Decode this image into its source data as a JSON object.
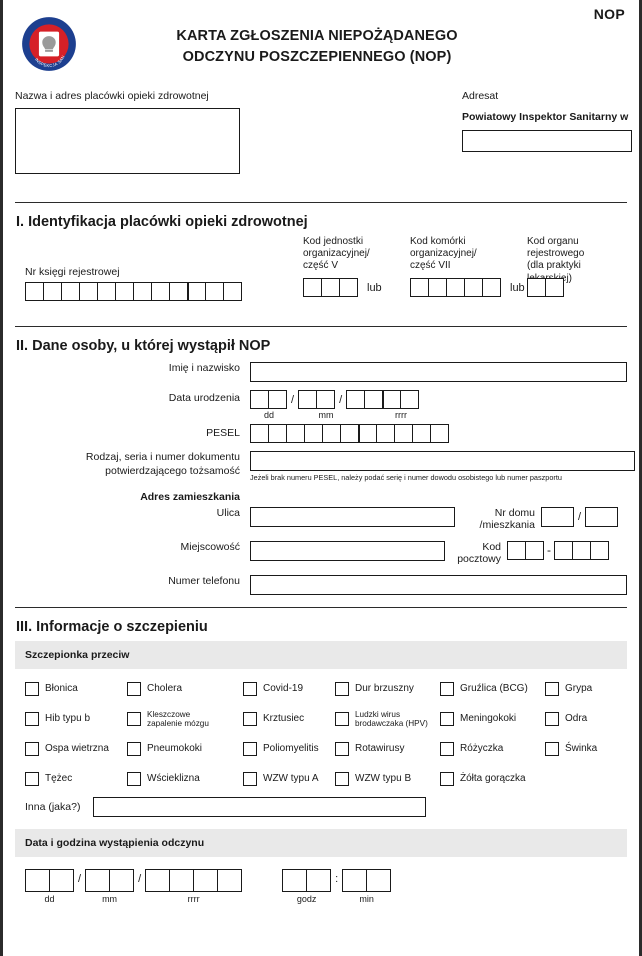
{
  "header": {
    "nop_tag": "NOP",
    "title_line1": "KARTA ZGŁOSZENIA NIEPOŻĄDANEGO",
    "title_line2": "ODCZYNU POSZCZEPIENNEGO (NOP)",
    "logo_top_text": "PAŃSTWOWA",
    "logo_bottom_text": "INSPEKCJA SANITARNA"
  },
  "top": {
    "facility_label": "Nazwa i adres placówki opieki zdrowotnej",
    "addressee_label": "Adresat",
    "addressee_value": "Powiatowy Inspektor Sanitarny w",
    "facility_value": "",
    "addressee_input_value": ""
  },
  "section1": {
    "title": "I. Identyfikacja placówki opieki zdrowotnej",
    "register_label": "Nr księgi rejestrowej",
    "register_boxes": 12,
    "register_divider_after": 9,
    "org_unit_label": "Kod jednostki\norganizacyjnej/\nczęść V",
    "org_unit_label_l1": "Kod jednostki",
    "org_unit_label_l2": "organizacyjnej/",
    "org_unit_label_l3": "część V",
    "org_unit_boxes": 3,
    "or_label": "lub",
    "cell_label_l1": "Kod komórki",
    "cell_label_l2": "organizacyjnej/",
    "cell_label_l3": "część VII",
    "cell_boxes": 5,
    "registry_label_l1": "Kod organu",
    "registry_label_l2": "rejestrowego",
    "registry_label_l3": "(dla praktyki lekarskiej)",
    "registry_boxes": 2
  },
  "section2": {
    "title": "II. Dane osoby, u której wystąpił NOP",
    "name_label": "Imię  i nazwisko",
    "name_value": "",
    "birth_label": "Data urodzenia",
    "birth_dd_boxes": 2,
    "birth_mm_boxes": 2,
    "birth_yyyy_boxes": 4,
    "tick_dd": "dd",
    "tick_mm": "mm",
    "tick_yyyy": "rrrr",
    "slash": "/",
    "pesel_label": "PESEL",
    "pesel_boxes": 11,
    "pesel_divider_after": 6,
    "doc_label_l1": "Rodzaj, seria i numer dokumentu",
    "doc_label_l2": "potwierdzającego tożsamość",
    "doc_value": "",
    "doc_hint": "Jeżeli brak numeru PESEL, należy podać serię i numer dowodu osobistego lub numer paszportu",
    "address_heading": "Adres zamieszkania",
    "street_label": "Ulica",
    "street_value": "",
    "house_label_l1": "Nr  domu",
    "house_label_l2": "/mieszkania",
    "house_value": "",
    "flat_value": "",
    "city_label": "Miejscowość",
    "city_value": "",
    "postcode_label_l1": "Kod",
    "postcode_label_l2": "pocztowy",
    "postcode_left_boxes": 2,
    "postcode_right_boxes": 3,
    "postcode_dash": "-",
    "phone_label": "Numer telefonu",
    "phone_value": ""
  },
  "section3": {
    "title": "III. Informacje o szczepieniu",
    "band_label": "Szczepionka przeciw",
    "vaccine_rows": [
      [
        {
          "label": "Błonica",
          "checked": false,
          "small": false
        },
        {
          "label": "Cholera",
          "checked": false,
          "small": false
        },
        {
          "label": "Covid-19",
          "checked": false,
          "small": false
        },
        {
          "label": "Dur brzuszny",
          "checked": false,
          "small": false
        },
        {
          "label": "Gruźlica (BCG)",
          "checked": false,
          "small": false
        },
        {
          "label": "Grypa",
          "checked": false,
          "small": false
        }
      ],
      [
        {
          "label": "Hib typu b",
          "checked": false,
          "small": false
        },
        {
          "label": "Kleszczowe\nzapalenie mózgu",
          "checked": false,
          "small": true
        },
        {
          "label": "Krztusiec",
          "checked": false,
          "small": false
        },
        {
          "label": "Ludzki wirus\nbrodawczaka (HPV)",
          "checked": false,
          "small": true
        },
        {
          "label": "Meningokoki",
          "checked": false,
          "small": false
        },
        {
          "label": "Odra",
          "checked": false,
          "small": false
        }
      ],
      [
        {
          "label": "Ospa wietrzna",
          "checked": false,
          "small": false
        },
        {
          "label": "Pneumokoki",
          "checked": false,
          "small": false
        },
        {
          "label": "Poliomyelitis",
          "checked": false,
          "small": false
        },
        {
          "label": "Rotawirusy",
          "checked": false,
          "small": false
        },
        {
          "label": "Różyczka",
          "checked": false,
          "small": false
        },
        {
          "label": "Świnka",
          "checked": false,
          "small": false
        }
      ],
      [
        {
          "label": "Tężec",
          "checked": false,
          "small": false
        },
        {
          "label": "Wścieklizna",
          "checked": false,
          "small": false
        },
        {
          "label": "WZW typu A",
          "checked": false,
          "small": false
        },
        {
          "label": "WZW typu B",
          "checked": false,
          "small": false
        },
        {
          "label": "Żółta gorączka",
          "checked": false,
          "small": false
        }
      ]
    ],
    "other_label": "Inna (jaka?)",
    "other_value": "",
    "datetime_band_label": "Data i godzina wystąpienia odczynu",
    "dt_dd_boxes": 2,
    "dt_mm_boxes": 2,
    "dt_yyyy_boxes": 4,
    "dt_hh_boxes": 2,
    "dt_min_boxes": 2,
    "dt_tick_dd": "dd",
    "dt_tick_mm": "mm",
    "dt_tick_yyyy": "rrrr",
    "dt_tick_hour": "godz",
    "dt_tick_min": "min",
    "dt_slash": "/",
    "dt_colon": ":"
  },
  "colors": {
    "band_gray": "#e9e9e9",
    "ink": "#1a1a1a",
    "logo_blue": "#1d3f8f",
    "logo_red": "#d62027"
  }
}
